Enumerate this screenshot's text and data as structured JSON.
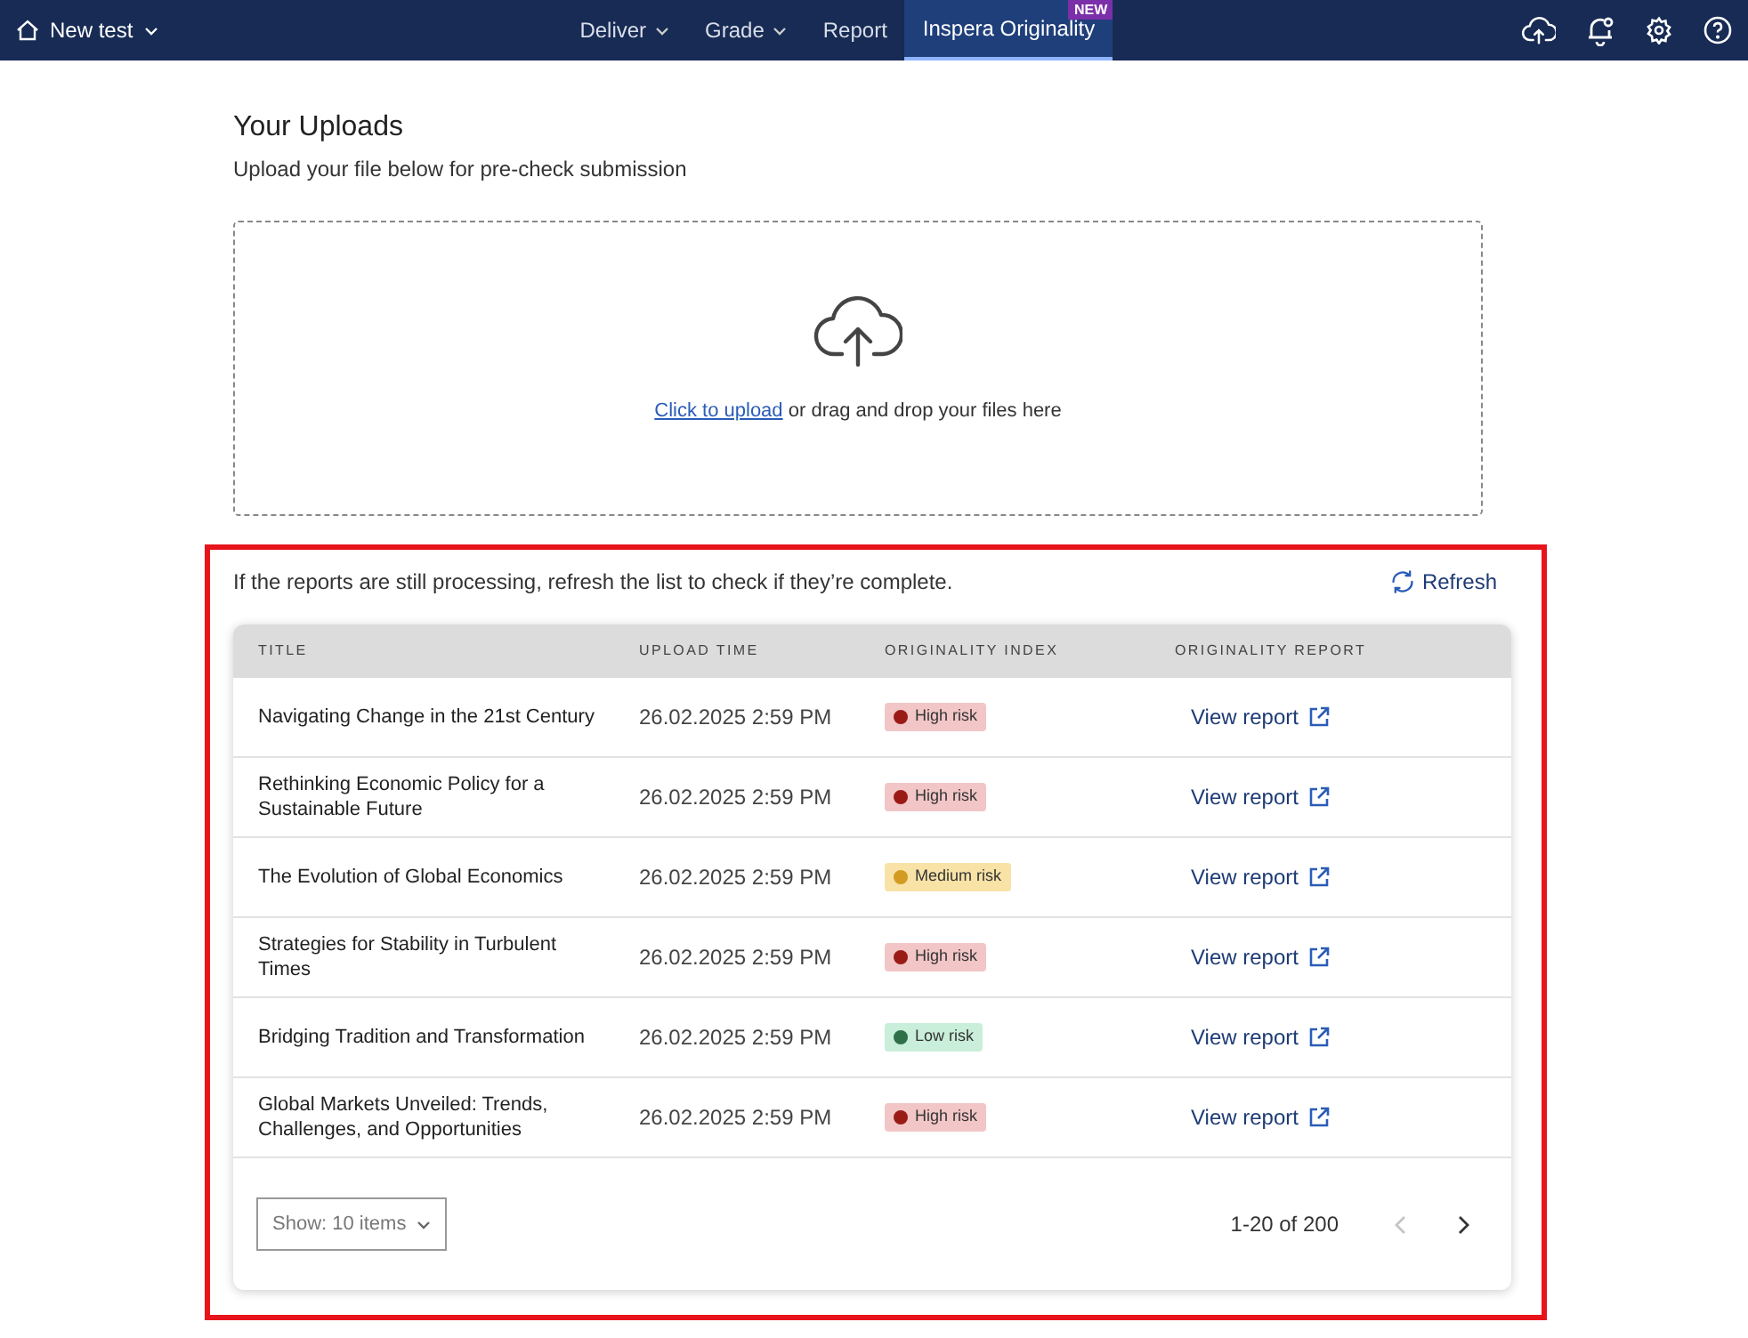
{
  "topbar": {
    "test_name": "New test",
    "nav": [
      {
        "label": "Deliver",
        "dropdown": true,
        "selected": false
      },
      {
        "label": "Grade",
        "dropdown": true,
        "selected": false
      },
      {
        "label": "Report",
        "dropdown": false,
        "selected": false
      },
      {
        "label": "Inspera Originality",
        "dropdown": false,
        "selected": true,
        "badge": "NEW"
      }
    ]
  },
  "uploads": {
    "title": "Your Uploads",
    "subtitle": "Upload your file below for pre-check submission",
    "dropzone": {
      "link": "Click to upload",
      "text": "or drag and drop your files here"
    }
  },
  "reports": {
    "notice": "If the reports are still processing, refresh the list to check if they’re complete.",
    "refresh": "Refresh",
    "columns": [
      "TITLE",
      "UPLOAD TIME",
      "ORIGINALITY INDEX",
      "ORIGINALITY REPORT"
    ],
    "rows": [
      {
        "title": "Navigating Change in the 21st Century",
        "time": "26.02.2025 2:59 PM",
        "risk": {
          "kind": "high",
          "label": "High risk"
        },
        "link": "View report"
      },
      {
        "title": "Rethinking Economic Policy for a Sustainable Future",
        "time": "26.02.2025 2:59 PM",
        "risk": {
          "kind": "high",
          "label": "High risk"
        },
        "link": "View report"
      },
      {
        "title": "The Evolution of Global Economics",
        "time": "26.02.2025 2:59 PM",
        "risk": {
          "kind": "medium",
          "label": "Medium risk"
        },
        "link": "View report"
      },
      {
        "title": "Strategies for Stability in Turbulent Times",
        "time": "26.02.2025 2:59 PM",
        "risk": {
          "kind": "high",
          "label": "High risk"
        },
        "link": "View report"
      },
      {
        "title": "Bridging Tradition and Transformation",
        "time": "26.02.2025 2:59 PM",
        "risk": {
          "kind": "low",
          "label": "Low risk"
        },
        "link": "View report"
      },
      {
        "title": "Global Markets Unveiled: Trends, Challenges, and Opportunities",
        "time": "26.02.2025 2:59 PM",
        "risk": {
          "kind": "high",
          "label": "High risk"
        },
        "link": "View report"
      }
    ],
    "page_size": "Show: 10 items",
    "range": "1-20 of 200",
    "prev_disabled": true,
    "next_disabled": false
  }
}
